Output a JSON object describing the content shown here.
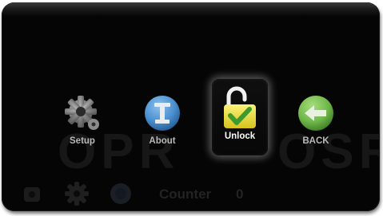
{
  "menu": {
    "items": [
      {
        "label": "Setup",
        "icon": "gear-icon"
      },
      {
        "label": "About",
        "icon": "info-icon"
      },
      {
        "label": "Unlock",
        "icon": "unlock-icon",
        "selected": true
      },
      {
        "label": "BACK",
        "icon": "back-arrow-icon"
      }
    ]
  },
  "background": {
    "ghost_left": "OPR",
    "ghost_right": "OSR",
    "counter_label": "Counter",
    "counter_value": "0"
  },
  "colors": {
    "frame": "#050505",
    "about_blue": "#4a8fd0",
    "back_green": "#6fb84a",
    "unlock_yellow": "#f5ea4a",
    "label_gray": "#b8b8b8",
    "selected_glow": "#c8c8c8"
  }
}
